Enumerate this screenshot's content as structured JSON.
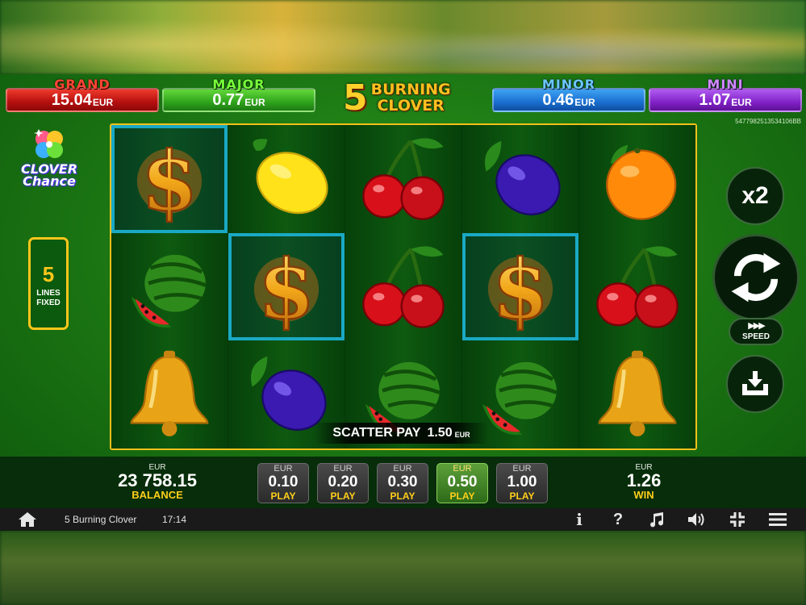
{
  "jackpots": [
    {
      "title": "GRAND",
      "amount": "15.04",
      "currency": "EUR",
      "color": "#c41212"
    },
    {
      "title": "MAJOR",
      "amount": "0.77",
      "currency": "EUR",
      "color": "#2fa41c"
    },
    {
      "title": "MINOR",
      "amount": "0.46",
      "currency": "EUR",
      "color": "#1a6fd0"
    },
    {
      "title": "MINI",
      "amount": "1.07",
      "currency": "EUR",
      "color": "#8122c8"
    }
  ],
  "logo": {
    "number": "5",
    "line1": "BURNING",
    "line2": "CLOVER"
  },
  "session_id": "5477982513534106BB",
  "clover_chance": {
    "line1": "CLOVER",
    "line2": "Chance"
  },
  "lines": {
    "count": "5",
    "label1": "LINES",
    "label2": "FIXED"
  },
  "reels": [
    [
      "dollar",
      "watermelon",
      "bell"
    ],
    [
      "lemon",
      "dollar",
      "plum"
    ],
    [
      "cherry",
      "cherry",
      "watermelon"
    ],
    [
      "plum",
      "dollar",
      "watermelon"
    ],
    [
      "orange",
      "cherry",
      "bell"
    ]
  ],
  "winning_cells": [
    [
      0,
      0
    ],
    [
      1,
      1
    ],
    [
      3,
      1
    ]
  ],
  "scatter_pay": {
    "label": "SCATTER PAY",
    "amount": "1.50",
    "currency": "EUR"
  },
  "controls": {
    "multiplier": "x2",
    "speed_label": "SPEED",
    "speed_icon": "fast-forward-icon",
    "spin_icon": "refresh-icon",
    "collect_icon": "collect-icon"
  },
  "balance": {
    "currency": "EUR",
    "amount": "23 758.15",
    "label": "BALANCE"
  },
  "win": {
    "currency": "EUR",
    "amount": "1.26",
    "label": "WIN"
  },
  "bets": [
    {
      "currency": "EUR",
      "amount": "0.10",
      "label": "PLAY",
      "active": false
    },
    {
      "currency": "EUR",
      "amount": "0.20",
      "label": "PLAY",
      "active": false
    },
    {
      "currency": "EUR",
      "amount": "0.30",
      "label": "PLAY",
      "active": false
    },
    {
      "currency": "EUR",
      "amount": "0.50",
      "label": "PLAY",
      "active": true
    },
    {
      "currency": "EUR",
      "amount": "1.00",
      "label": "PLAY",
      "active": false
    }
  ],
  "sysbar": {
    "game_name": "5 Burning Clover",
    "clock": "17:14",
    "icons": [
      "info-icon",
      "help-icon",
      "music-icon",
      "volume-icon",
      "fullscreen-exit-icon",
      "menu-icon"
    ],
    "info_glyph": "i",
    "help_glyph": "?"
  }
}
